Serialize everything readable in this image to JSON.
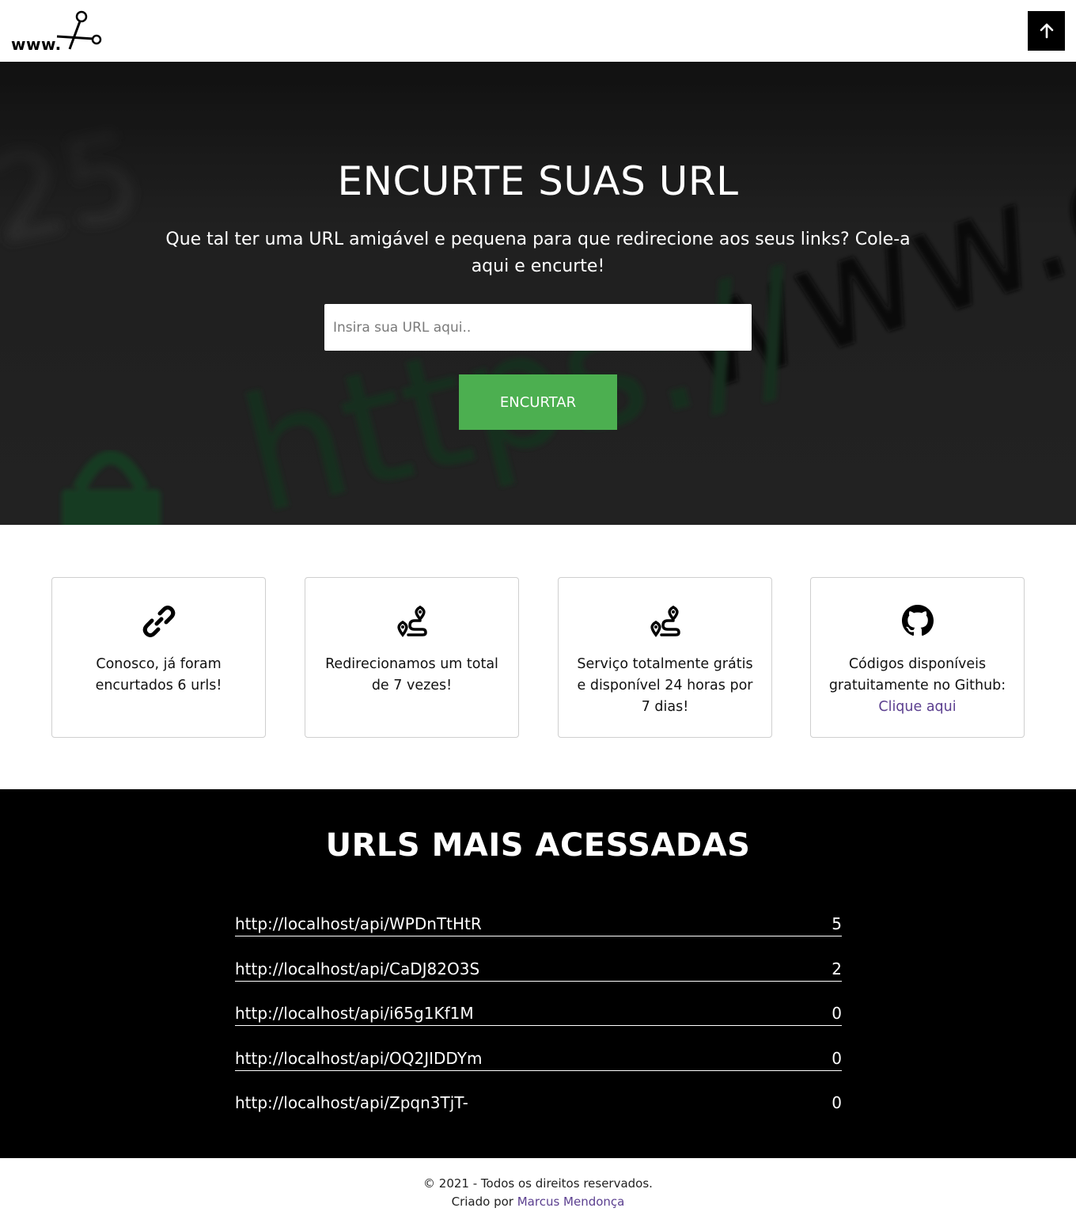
{
  "header": {
    "logo_text": "www.",
    "scroll_top_icon": "arrow-up-icon"
  },
  "hero": {
    "title": "ENCURTE SUAS URL",
    "subtitle": "Que tal ter uma URL amigável e pequena para que redirecione aos seus links? Cole-a aqui e encurte!",
    "input_placeholder": "Insira sua URL aqui..",
    "input_value": "",
    "button_label": "ENCURTAR",
    "button_color": "#4caf50"
  },
  "features": [
    {
      "icon": "link-icon",
      "text": "Conosco, já foram encurtados 6 urls!"
    },
    {
      "icon": "route-icon",
      "text": "Redirecionamos um total de 7 vezes!"
    },
    {
      "icon": "route-icon",
      "text": "Serviço totalmente grátis e disponível 24 horas por 7 dias!"
    },
    {
      "icon": "github-icon",
      "text": "Códigos disponíveis gratuitamente no Github:",
      "link_label": "Clique aqui"
    }
  ],
  "ranking": {
    "title": "URLS MAIS ACESSADAS",
    "rows": [
      {
        "url": "http://localhost/api/WPDnTtHtR",
        "count": "5"
      },
      {
        "url": "http://localhost/api/CaDJ82O3S",
        "count": "2"
      },
      {
        "url": "http://localhost/api/i65g1Kf1M",
        "count": "0"
      },
      {
        "url": "http://localhost/api/OQ2JIDDYm",
        "count": "0"
      },
      {
        "url": "http://localhost/api/Zpqn3TjT-",
        "count": "0"
      }
    ]
  },
  "footer": {
    "copyright": "© 2021 - Todos os direitos reservados.",
    "created_by": "Criado por",
    "author": "Marcus Mendonça",
    "link_color": "#5b3f8f"
  }
}
